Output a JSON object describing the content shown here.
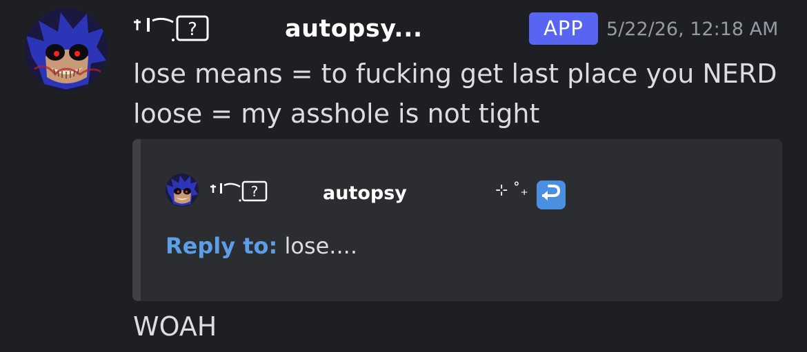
{
  "message": {
    "author_glyphs": "† Ι⌒.",
    "author_name": "autopsy...",
    "badge": "APP",
    "timestamp": "5/22/26, 12:18 AM",
    "content_lines": [
      "lose means = to fucking get last place you NERD",
      "loose = my asshole is not tight"
    ],
    "avatar_icon": "sonic-exe-avatar"
  },
  "embed": {
    "author_name": "autopsy",
    "sparkle": "⊹ ˚₊",
    "reply_icon": "reply-arrow-icon",
    "reply_label": "Reply to:",
    "reply_text": " lose....",
    "bar_color": "#3f4147",
    "link_color": "#5c9ee8"
  },
  "followup": {
    "text": "WOAH"
  },
  "colors": {
    "background": "#1e1f22",
    "badge": "#5865f2",
    "embed_background": "#2b2d31",
    "timestamp": "#949ba4"
  }
}
